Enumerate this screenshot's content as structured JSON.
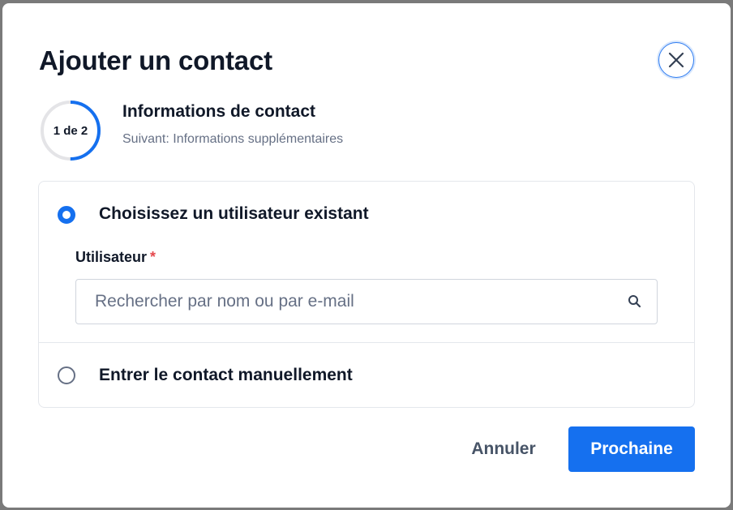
{
  "dialog": {
    "title": "Ajouter un contact",
    "close_icon": "close-icon"
  },
  "stepper": {
    "label": "1 de 2",
    "current_step": 1,
    "total_steps": 2,
    "progress": 0.5,
    "title": "Informations de contact",
    "next": "Suivant: Informations supplémentaires"
  },
  "options": {
    "existing": {
      "label": "Choisissez un utilisateur existant",
      "selected": true
    },
    "user_field": {
      "label": "Utilisateur",
      "required_mark": "*",
      "placeholder": "Rechercher par nom ou par e-mail",
      "value": "",
      "icon": "search-icon"
    },
    "manual": {
      "label": "Entrer le contact manuellement",
      "selected": false
    }
  },
  "footer": {
    "cancel_label": "Annuler",
    "next_label": "Prochaine"
  },
  "colors": {
    "accent": "#1570ef",
    "required": "#e5484d",
    "progress_track": "#e4e4e7",
    "text_primary": "#101828",
    "text_secondary": "#667085"
  }
}
